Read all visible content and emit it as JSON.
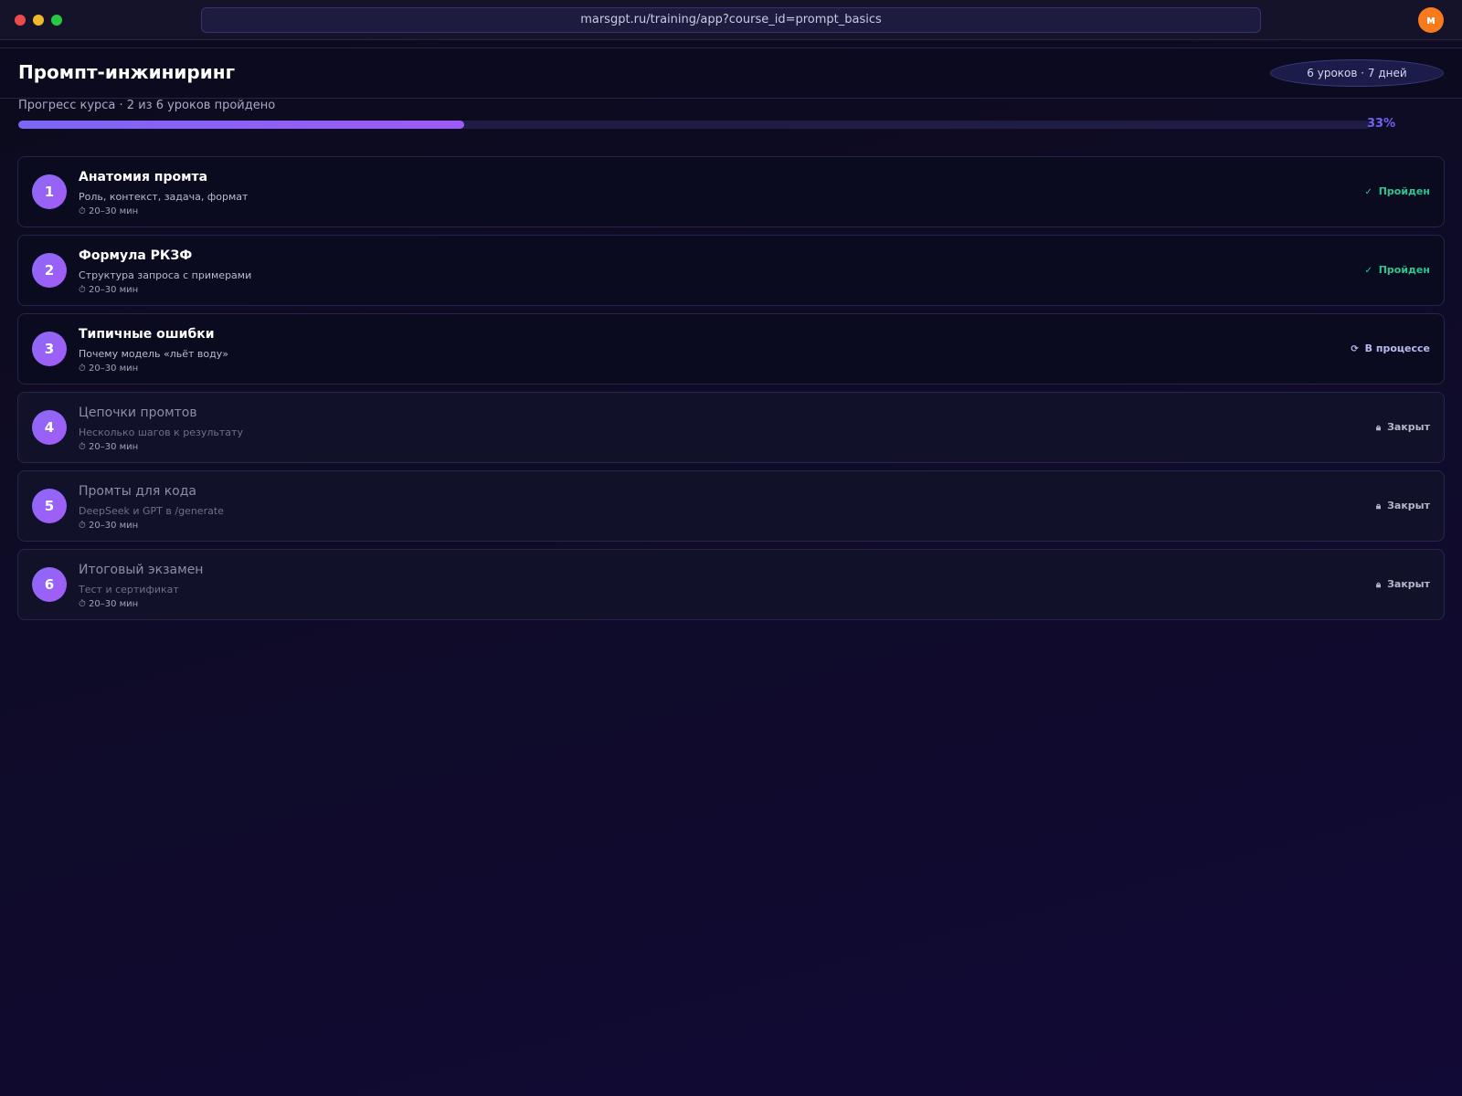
{
  "browser": {
    "url": "marsgpt.ru/training/app?course_id=prompt_basics",
    "avatar_letter": "м"
  },
  "course": {
    "title": "Промпт-инжиниринг",
    "meta": "6 уроков · 7 дней",
    "progress_label": "Прогресс курса · 2 из 6 уроков пройдено",
    "progress_percent_text": "33%",
    "progress_fraction": 0.33
  },
  "lessons": [
    {
      "num": "1",
      "title": "Анатомия промта",
      "desc": "Роль, контекст, задача, формат",
      "time": "20–30 мин",
      "status": "done",
      "status_label": "Пройден",
      "status_icon": "check-icon"
    },
    {
      "num": "2",
      "title": "Формула РКЗФ",
      "desc": "Структура запроса с примерами",
      "time": "20–30 мин",
      "status": "done",
      "status_label": "Пройден",
      "status_icon": "check-icon"
    },
    {
      "num": "3",
      "title": "Типичные ошибки",
      "desc": "Почему модель «льёт воду»",
      "time": "20–30 мин",
      "status": "in_progress",
      "status_label": "В процессе",
      "status_icon": "refresh-icon"
    },
    {
      "num": "4",
      "title": "Цепочки промтов",
      "desc": "Несколько шагов к результату",
      "time": "20–30 мин",
      "status": "locked",
      "status_label": "Закрыт",
      "status_icon": "lock-icon"
    },
    {
      "num": "5",
      "title": "Промты для кода",
      "desc": "DeepSeek и GPT в /generate",
      "time": "20–30 мин",
      "status": "locked",
      "status_label": "Закрыт",
      "status_icon": "lock-icon"
    },
    {
      "num": "6",
      "title": "Итоговый экзамен",
      "desc": "Тест и сертификат",
      "time": "20–30 мин",
      "status": "locked",
      "status_label": "Закрыт",
      "status_icon": "lock-icon"
    }
  ],
  "colors": {
    "accent": "#8b6af6",
    "done": "#2ec48f",
    "progress_text": "#6f63f0",
    "avatar": "#f77b1e"
  }
}
